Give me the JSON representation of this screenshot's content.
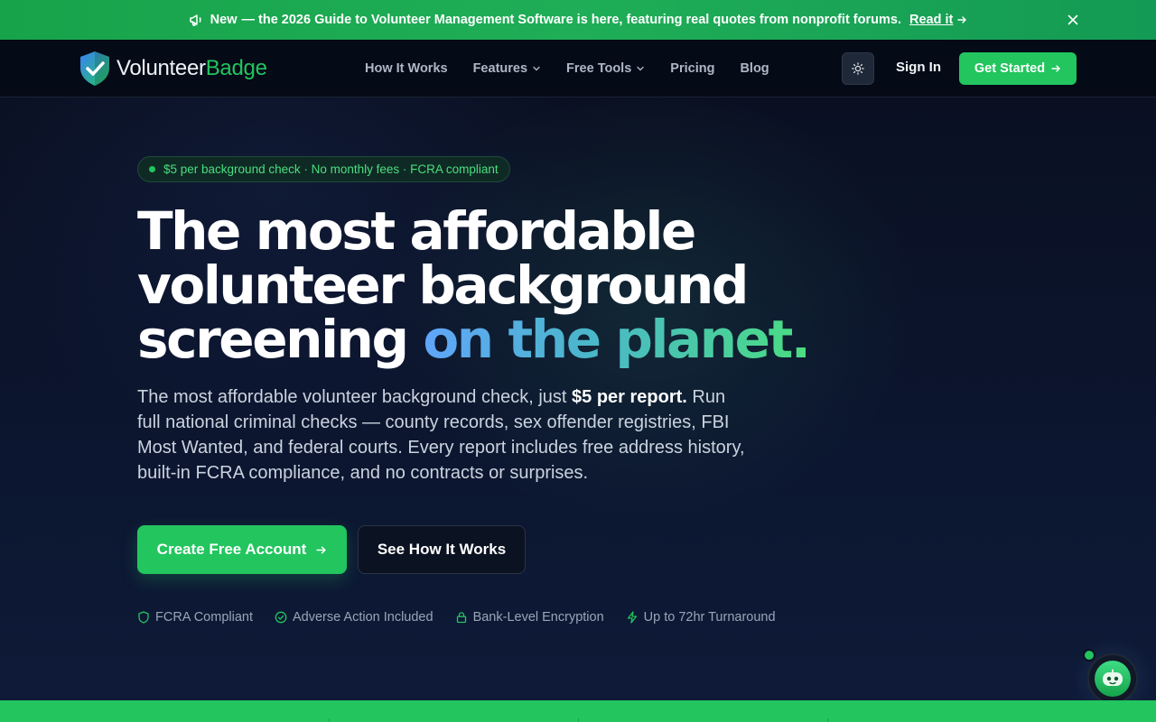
{
  "announcement": {
    "new_label": "New",
    "text": "— the 2026 Guide to Volunteer Management Software is here, featuring real quotes from nonprofit forums.",
    "link_label": "Read it",
    "icon": "megaphone-icon",
    "close_icon": "close-icon"
  },
  "nav": {
    "brand_part1": "Volunteer",
    "brand_part2": "Badge",
    "items": [
      {
        "label": "How It Works",
        "has_dropdown": false
      },
      {
        "label": "Features",
        "has_dropdown": true
      },
      {
        "label": "Free Tools",
        "has_dropdown": true
      },
      {
        "label": "Pricing",
        "has_dropdown": false
      },
      {
        "label": "Blog",
        "has_dropdown": false
      }
    ],
    "theme_icon": "sun-icon",
    "signin_label": "Sign In",
    "cta_label": "Get Started"
  },
  "hero": {
    "badge": "$5 per background check · No monthly fees · FCRA compliant",
    "title_line1": "The most affordable",
    "title_line2": "volunteer background",
    "title_line3_plain": "screening",
    "title_line3_gradient": "on the planet.",
    "lead_before": "The most affordable volunteer background check, just ",
    "lead_bold": "$5 per report.",
    "lead_after": " Run full national criminal checks — county records, sex offender registries, FBI Most Wanted, and federal courts. Every report includes free address history, built-in FCRA compliance, and no contracts or surprises.",
    "primary_cta": "Create Free Account",
    "secondary_cta": "See How It Works",
    "trust": [
      {
        "icon": "shield-icon",
        "label": "FCRA Compliant"
      },
      {
        "icon": "check-circle-icon",
        "label": "Adverse Action Included"
      },
      {
        "icon": "lock-icon",
        "label": "Bank-Level Encryption"
      },
      {
        "icon": "lightning-icon",
        "label": "Up to 72hr Turnaround"
      }
    ]
  },
  "colors": {
    "accent": "#22c55e",
    "background": "#0b1122",
    "gradient_start": "#60a5fa",
    "gradient_end": "#4ade80"
  }
}
